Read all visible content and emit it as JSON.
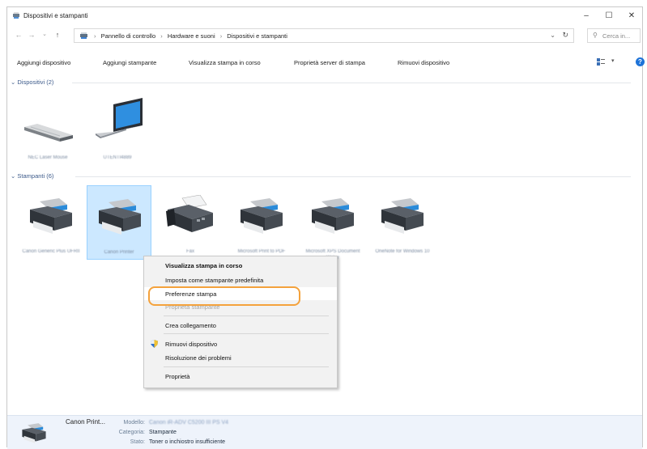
{
  "window": {
    "title": "Dispositivi e stampanti",
    "controls": {
      "minimize": "–",
      "maximize": "☐",
      "close": "✕"
    }
  },
  "address": {
    "crumbs": [
      "Pannello di controllo",
      "Hardware e suoni",
      "Dispositivi e stampanti"
    ],
    "search_placeholder": "Cerca in..."
  },
  "toolbar": {
    "add_device": "Aggiungi dispositivo",
    "add_printer": "Aggiungi stampante",
    "see_printing": "Visualizza stampa in corso",
    "print_server": "Proprietà server di stampa",
    "remove_device": "Rimuovi dispositivo"
  },
  "groups": {
    "devices": {
      "header": "Dispositivi (2)",
      "items": [
        {
          "label": "NEC Laser Mouse",
          "icon": "mouse-icon"
        },
        {
          "label": "UTENTI4889",
          "icon": "laptop-icon"
        }
      ]
    },
    "printers": {
      "header": "Stampanti (6)",
      "items": [
        {
          "label": "Canon Generic Plus UFRII",
          "icon": "printer-icon"
        },
        {
          "label": "Canon Printer",
          "icon": "printer-icon",
          "selected": true
        },
        {
          "label": "Fax",
          "icon": "fax-icon"
        },
        {
          "label": "Microsoft Print to PDF",
          "icon": "printer-icon"
        },
        {
          "label": "Microsoft XPS Document Writer",
          "icon": "printer-icon"
        },
        {
          "label": "OneNote for Windows 10",
          "icon": "printer-icon"
        }
      ]
    }
  },
  "context_menu": {
    "items": {
      "see_printing": "Visualizza stampa in corso",
      "set_default": "Imposta come stampante predefinita",
      "preferences": "Preferenze stampa",
      "properties_printer": "Proprietà stampante",
      "create_shortcut": "Crea collegamento",
      "remove_device": "Rimuovi dispositivo",
      "troubleshoot": "Risoluzione dei problemi",
      "properties": "Proprietà"
    }
  },
  "details": {
    "name": "Canon Print...",
    "model_key": "Modello:",
    "model_val": "Canon iR-ADV C5200 III PS V4",
    "category_key": "Categoria:",
    "category_val": "Stampante",
    "status_key": "Stato:",
    "status_val": "Toner o inchiostro insufficiente"
  },
  "colors": {
    "accent": "#1e73d8",
    "selection": "#cce8ff",
    "highlight_ring": "#f4a23c"
  }
}
